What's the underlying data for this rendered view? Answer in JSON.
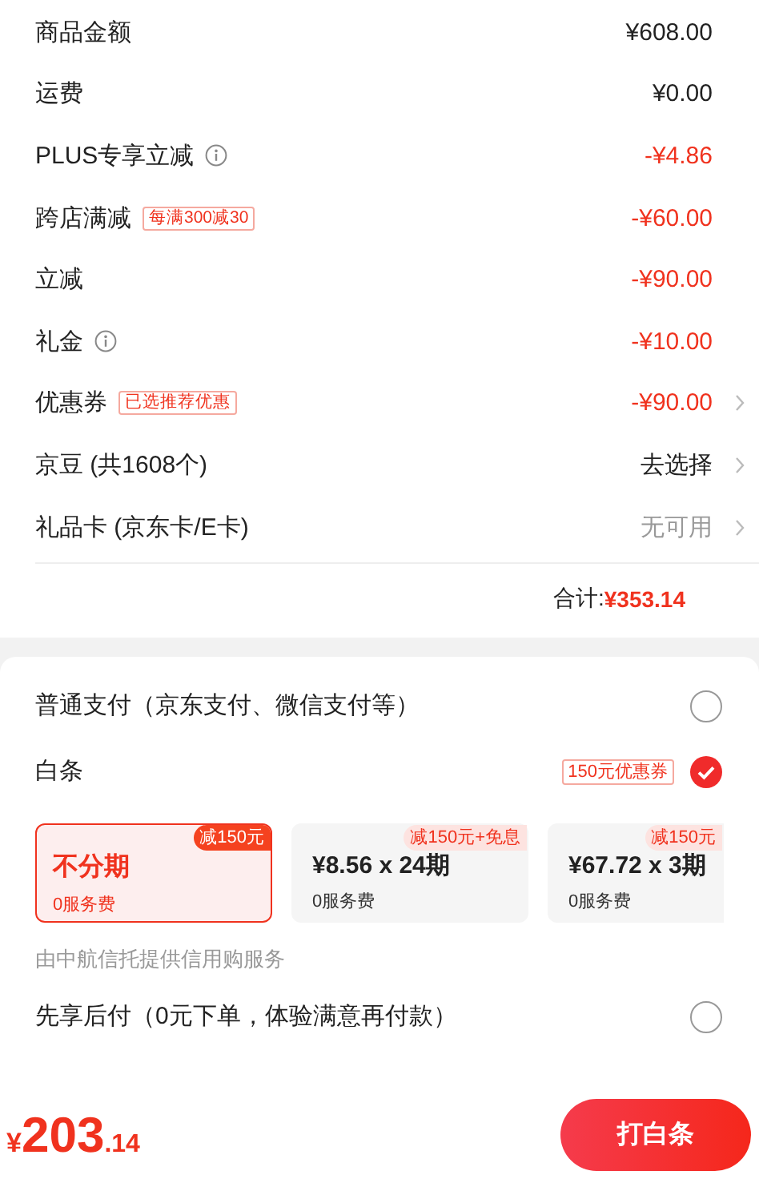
{
  "fees": [
    {
      "label": "商品金额",
      "value": "¥608.00",
      "kind": "normal",
      "info": false,
      "chevron": false
    },
    {
      "label": "运费",
      "value": "¥0.00",
      "kind": "normal",
      "info": false,
      "chevron": false
    },
    {
      "label": "PLUS专享立减",
      "value": "-¥4.86",
      "kind": "discount",
      "info": true,
      "chevron": false
    },
    {
      "label": "跨店满减",
      "tag": "每满300减30",
      "value": "-¥60.00",
      "kind": "discount",
      "info": false,
      "chevron": false
    },
    {
      "label": "立减",
      "value": "-¥90.00",
      "kind": "discount",
      "info": false,
      "chevron": false
    },
    {
      "label": "礼金",
      "value": "-¥10.00",
      "kind": "discount",
      "info": true,
      "chevron": false
    },
    {
      "label": "优惠券",
      "tag": "已选推荐优惠",
      "value": "-¥90.00",
      "kind": "discount",
      "info": false,
      "chevron": true
    },
    {
      "label": "京豆 (共1608个)",
      "value": "去选择",
      "kind": "normal",
      "info": false,
      "chevron": true
    },
    {
      "label": "礼品卡 (京东卡/E卡)",
      "value": "无可用",
      "kind": "muted",
      "info": false,
      "chevron": true
    }
  ],
  "total": {
    "label": "合计:",
    "value": "¥353.14"
  },
  "payment_methods": [
    {
      "label": "普通支付（京东支付、微信支付等）",
      "selected": false
    },
    {
      "label": "白条",
      "selected": true,
      "coupon": "150元优惠券",
      "plans": [
        {
          "title": "不分期",
          "fee": "0服务费",
          "badge": "减150元",
          "selected": true
        },
        {
          "title": "¥8.56 x 24期",
          "fee": "0服务费",
          "badge": "减150元+免息",
          "selected": false
        },
        {
          "title": "¥67.72 x 3期",
          "fee": "0服务费",
          "badge": "减150元",
          "selected": false
        }
      ],
      "note": "由中航信托提供信用购服务"
    },
    {
      "label": "先享后付（0元下单，体验满意再付款）",
      "selected": false
    }
  ],
  "footer": {
    "price": {
      "currency": "¥",
      "integer": "203",
      "decimal": ".14"
    },
    "button": "打白条"
  }
}
